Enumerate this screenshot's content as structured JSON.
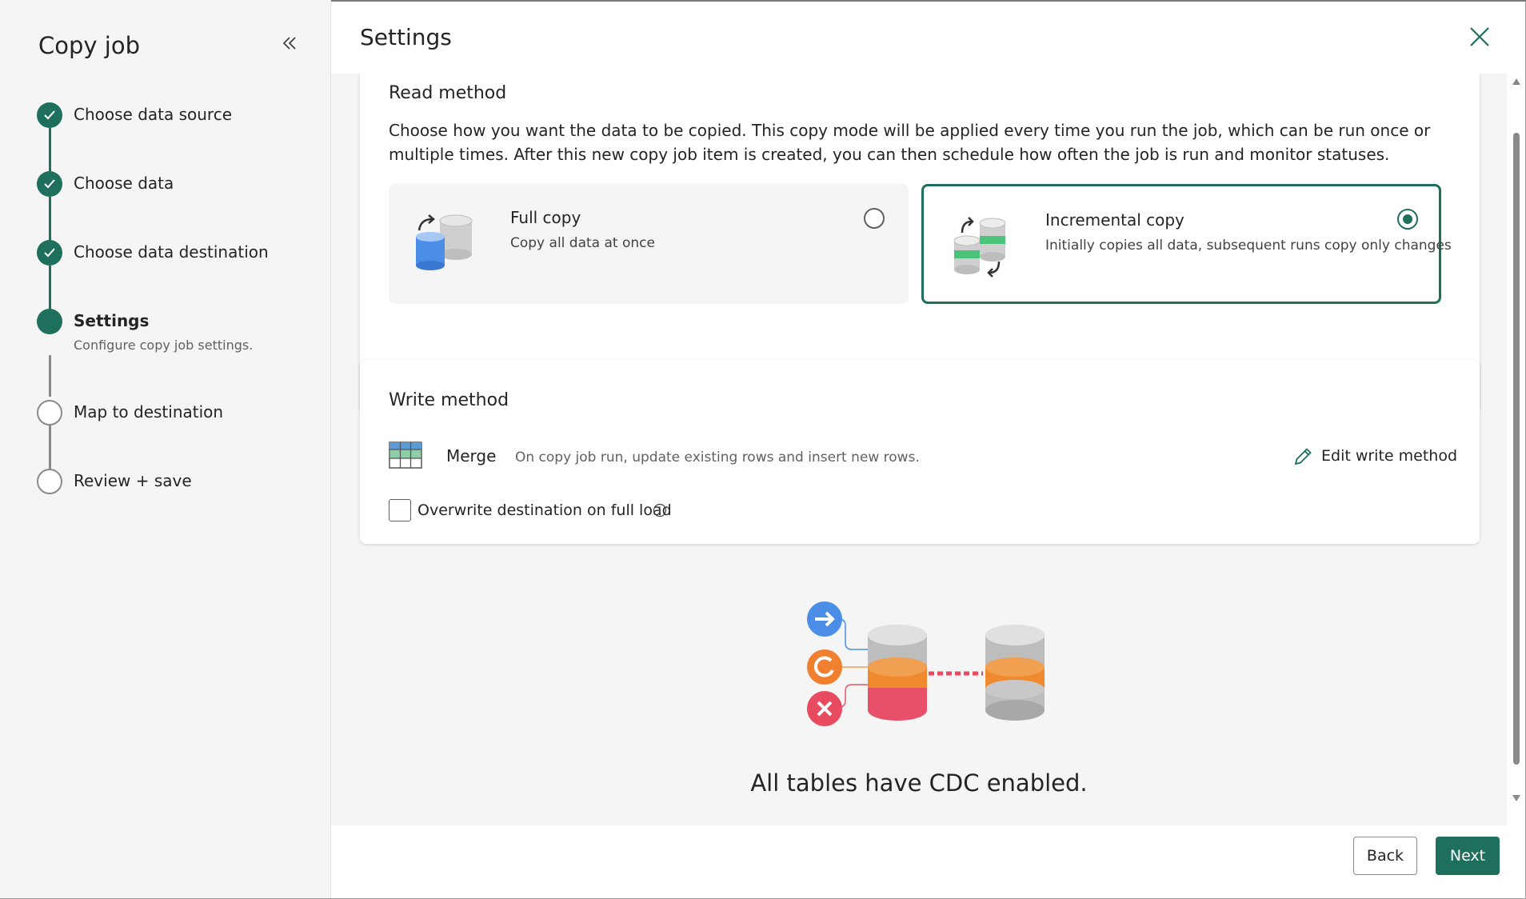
{
  "sidebar": {
    "title": "Copy job",
    "steps": [
      {
        "label": "Choose data source",
        "state": "done"
      },
      {
        "label": "Choose data",
        "state": "done"
      },
      {
        "label": "Choose data destination",
        "state": "done"
      },
      {
        "label": "Settings",
        "sub": "Configure copy job settings.",
        "state": "active"
      },
      {
        "label": "Map to destination",
        "state": "todo"
      },
      {
        "label": "Review + save",
        "state": "todo"
      }
    ]
  },
  "header": {
    "title": "Settings"
  },
  "read_method": {
    "title": "Read method",
    "description": "Choose how you want the data to be copied. This copy mode will be applied every time you run the job, which can be run once or multiple times. After this new copy job item is created, you can then schedule how often the job is run and monitor statuses.",
    "options": [
      {
        "title": "Full copy",
        "desc": "Copy all data at once",
        "selected": false
      },
      {
        "title": "Incremental copy",
        "desc": "Initially copies all data, subsequent runs copy only changes",
        "selected": true
      }
    ]
  },
  "write_method": {
    "title": "Write method",
    "mode": "Merge",
    "mode_desc": "On copy job run, update existing rows and insert new rows.",
    "edit_label": "Edit write method",
    "overwrite_label": "Overwrite destination on full load"
  },
  "cdc": {
    "message": "All tables have CDC enabled."
  },
  "footer": {
    "back_label": "Back",
    "next_label": "Next"
  },
  "colors": {
    "accent": "#1e6f5c",
    "sidebar_bg": "#f5f5f5"
  }
}
